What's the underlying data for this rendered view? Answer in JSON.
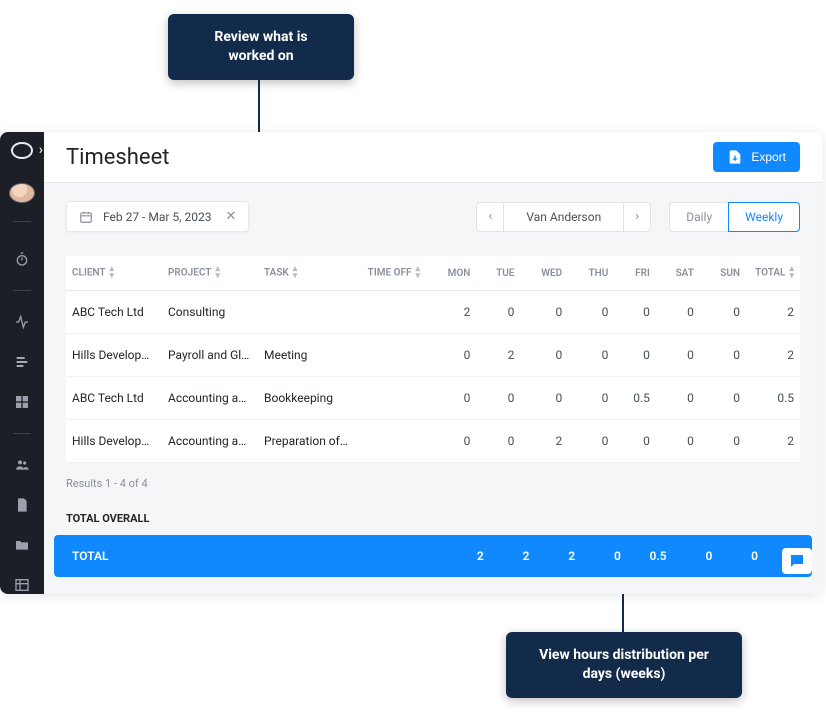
{
  "annotations": {
    "top": "Review what is worked on",
    "bottom": "View hours distribution per days (weeks)"
  },
  "header": {
    "title": "Timesheet",
    "export_label": "Export"
  },
  "controls": {
    "date_range": "Feb 27 - Mar 5, 2023",
    "user_name": "Van Anderson",
    "toggle_daily": "Daily",
    "toggle_weekly": "Weekly"
  },
  "table": {
    "columns": {
      "client": "CLIENT",
      "project": "PROJECT",
      "task": "TASK",
      "time_off": "TIME OFF",
      "mon": "MON",
      "tue": "TUE",
      "wed": "WED",
      "thu": "THU",
      "fri": "FRI",
      "sat": "SAT",
      "sun": "SUN",
      "total": "TOTAL"
    },
    "rows": [
      {
        "client": "ABC Tech Ltd",
        "project": "Consulting",
        "task": "",
        "time_off": "",
        "mon": "2",
        "tue": "0",
        "wed": "0",
        "thu": "0",
        "fri": "0",
        "sat": "0",
        "sun": "0",
        "total": "2"
      },
      {
        "client": "Hills Development",
        "project": "Payroll and Glob…",
        "task": "Meeting",
        "time_off": "",
        "mon": "0",
        "tue": "2",
        "wed": "0",
        "thu": "0",
        "fri": "0",
        "sat": "0",
        "sun": "0",
        "total": "2"
      },
      {
        "client": "ABC Tech Ltd",
        "project": "Accounting and …",
        "task": "Bookkeeping",
        "time_off": "",
        "mon": "0",
        "tue": "0",
        "wed": "0",
        "thu": "0",
        "fri": "0.5",
        "sat": "0",
        "sun": "0",
        "total": "0.5"
      },
      {
        "client": "Hills Development",
        "project": "Accounting and …",
        "task": "Preparation of a…",
        "time_off": "",
        "mon": "0",
        "tue": "0",
        "wed": "2",
        "thu": "0",
        "fri": "0",
        "sat": "0",
        "sun": "0",
        "total": "2"
      }
    ],
    "results_info": "Results 1 - 4 of 4",
    "overall_label": "TOTAL OVERALL",
    "totals": {
      "label": "TOTAL",
      "mon": "2",
      "tue": "2",
      "wed": "2",
      "thu": "0",
      "fri": "0.5",
      "sat": "0",
      "sun": "0"
    }
  },
  "sidebar_icons": [
    "timer",
    "activity",
    "list",
    "grid",
    "users",
    "file",
    "folder",
    "table"
  ]
}
